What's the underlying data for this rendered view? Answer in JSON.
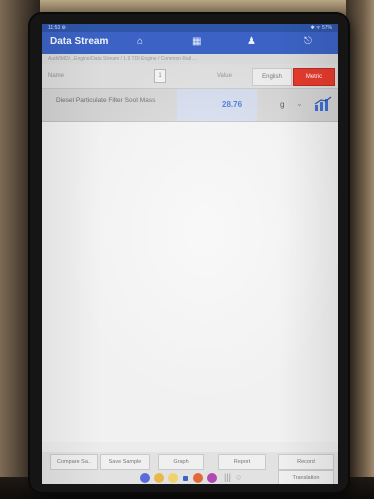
{
  "photo": {
    "description_note": ""
  },
  "status_bar": {
    "time": "11:53 ⚙",
    "system_icons": "✱ ᯤ 57%"
  },
  "header": {
    "title": "Data Stream",
    "icons": [
      "home-icon",
      "menu-icon",
      "user-icon",
      "exit-icon"
    ]
  },
  "breadcrumb": "Audi/IMD/...Engine/Data Stream / 1.9 TDI Engine / Common Rail ...",
  "table_header": {
    "name_label": "Name",
    "page_number": "1",
    "value_label": "Value",
    "language_button": "English",
    "units_button": "Metric"
  },
  "rows": [
    {
      "name": "Diesel Particulate Filter Soot Mass",
      "value": "28.76",
      "unit": "g"
    }
  ],
  "toolbar": {
    "compare": "Compare Sa..",
    "save_sample": "Save Sample",
    "graph": "Graph",
    "report": "Report",
    "record": "Record",
    "translation": "Translation"
  },
  "colors": {
    "header": "#3b62c4",
    "units_button": "#e53b2e",
    "value_text": "#3d6fd0"
  }
}
